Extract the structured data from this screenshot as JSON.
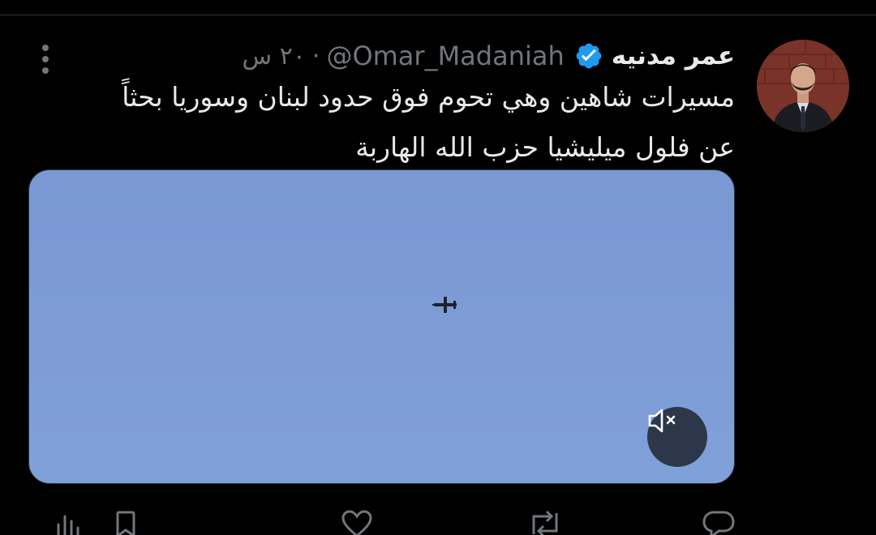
{
  "tweet": {
    "display_name": "عمر مدنيه",
    "handle": "@Omar_Madaniah",
    "separator": "·",
    "time": "٢٠ س",
    "text_line1": "مسيرات شاهين وهي تحوم فوق حدود لبنان وسوريا بحثاً",
    "text_line2": "عن فلول ميليشيا حزب الله الهاربة",
    "verified": true
  },
  "icons": {
    "verified": "verified-badge-icon",
    "more": "more-vertical-icon",
    "mute": "speaker-muted-icon",
    "analytics": "analytics-icon",
    "bookmark": "bookmark-icon",
    "share": "share-icon",
    "like": "heart-icon",
    "retweet": "retweet-icon",
    "reply": "reply-icon"
  },
  "colors": {
    "background": "#000000",
    "primary_text": "#e7e9ea",
    "secondary_text": "#71767b",
    "verified_blue": "#1d9bf0",
    "sky": "#7d9cd6"
  }
}
